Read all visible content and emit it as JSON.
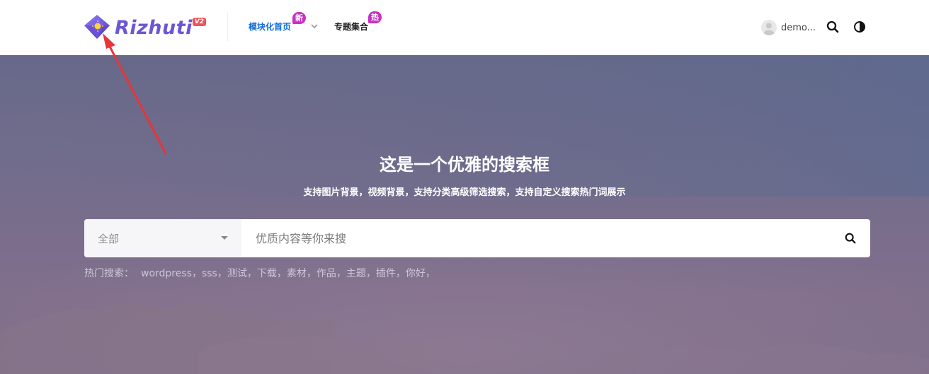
{
  "header": {
    "logo_text": "Rizhuti",
    "logo_badge": "V2",
    "nav": [
      {
        "label": "模块化首页",
        "badge": "新",
        "active": true
      },
      {
        "label": "专题集合",
        "badge": "热",
        "active": false
      }
    ],
    "user_name": "demo..."
  },
  "hero": {
    "title": "这是一个优雅的搜索框",
    "subtitle": "支持图片背景，视频背景，支持分类高级筛选搜索，支持自定义搜索热门词展示",
    "category_selected": "全部",
    "search_placeholder": "优质内容等你来搜",
    "hot_label": "热门搜索：",
    "hot_terms": [
      "wordpress，",
      "sss，",
      "测试，",
      "下载，",
      "素材，",
      "作品，",
      "主题，",
      "插件，",
      "你好，"
    ]
  },
  "colors": {
    "brand": "#6a56d6",
    "nav_active": "#0f6bd6",
    "badge": "#c831c4",
    "annotation": "#e8343a"
  },
  "icons": [
    "gem-logo-icon",
    "chevron-down-icon",
    "avatar-icon",
    "search-icon",
    "contrast-icon",
    "caret-down-icon"
  ]
}
